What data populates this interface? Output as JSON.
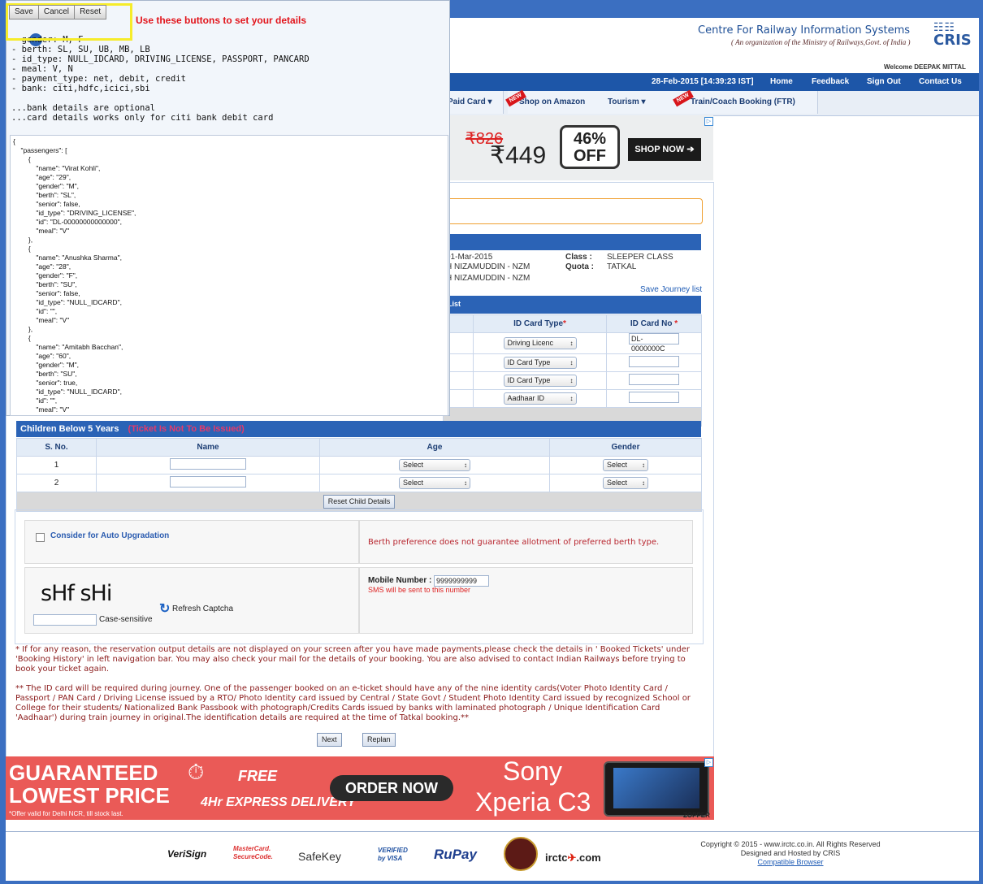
{
  "overlay": {
    "buttons": {
      "save": "Save",
      "cancel": "Cancel",
      "reset": "Reset"
    },
    "hint": "Use these buttons to set your details",
    "config_text": "- gender: M, F\n- berth: SL, SU, UB, MB, LB\n- id_type: NULL_IDCARD, DRIVING_LICENSE, PASSPORT, PANCARD\n- meal: V, N\n- payment_type: net, debit, credit\n- bank: citi,hdfc,icici,sbi\n\n...bank details are optional\n...card details works only for citi bank debit card",
    "json_text": "{\n    \"passengers\": [\n        {\n            \"name\": \"Virat Kohli\",\n            \"age\": \"29\",\n            \"gender\": \"M\",\n            \"berth\": \"SL\",\n            \"senior\": false,\n            \"id_type\": \"DRIVING_LICENSE\",\n            \"id\": \"DL-00000000000000\",\n            \"meal\": \"V\"\n        },\n        {\n            \"name\": \"Anushka Sharma\",\n            \"age\": \"28\",\n            \"gender\": \"F\",\n            \"berth\": \"SU\",\n            \"senior\": false,\n            \"id_type\": \"NULL_IDCARD\",\n            \"id\": \"\",\n            \"meal\": \"V\"\n        },\n        {\n            \"name\": \"Amitabh Bacchan\",\n            \"age\": \"60\",\n            \"gender\": \"M\",\n            \"berth\": \"SU\",\n            \"senior\": true,\n            \"id_type\": \"NULL_IDCARD\",\n            \"id\": \"\",\n            \"meal\": \"V\""
  },
  "header": {
    "title": "Centre For Railway Information Systems",
    "subtitle": "( An organization of the Ministry of Railways,Govt. of India )",
    "logo_text": "CRIS",
    "welcome": "Welcome DEEPAK MITTAL",
    "datetime": "28-Feb-2015 [14:39:23 IST]",
    "links": [
      "Home",
      "Feedback",
      "Sign Out",
      "Contact Us"
    ]
  },
  "menu": {
    "items": [
      "Paid Card ▾",
      "Shop on Amazon",
      "Tourism ▾",
      "Train/Coach Booking (FTR)"
    ],
    "new_badge": "NEW"
  },
  "ad_top": {
    "old_price": "₹826",
    "new_price": "₹449",
    "discount": "46%",
    "off": "OFF",
    "cta": "SHOP NOW"
  },
  "journey": {
    "date": "01-Mar-2015",
    "from": "H NIZAMUDDIN - NZM",
    "to": "H NIZAMUDDIN - NZM",
    "class_label": "Class :",
    "class_value": "SLEEPER CLASS",
    "quota_label": "Quota :",
    "quota_value": "TATKAL",
    "save_link": "Save Journey list",
    "list_label": "r List"
  },
  "passengers_table": {
    "headers": [
      "ID Card Type",
      "ID Card No"
    ],
    "rows": [
      {
        "id_type": "Driving Licenc",
        "id_no": "DL-0000000C"
      },
      {
        "id_type": "ID Card Type",
        "id_no": ""
      },
      {
        "id_type": "ID Card Type",
        "id_no": ""
      },
      {
        "id_type": "Aadhaar ID",
        "id_no": ""
      }
    ]
  },
  "children": {
    "title": "Children Below 5 Years",
    "warning": "(Ticket Is Not To Be Issued)",
    "headers": [
      "S. No.",
      "Name",
      "Age",
      "Gender"
    ],
    "rows": [
      {
        "sno": "1",
        "age": "Select",
        "gender": "Select"
      },
      {
        "sno": "2",
        "age": "Select",
        "gender": "Select"
      }
    ],
    "reset_button": "Reset Child Details"
  },
  "options": {
    "auto_upgrade": "Consider for Auto Upgradation",
    "berth_note": "Berth preference does not guarantee allotment of preferred berth type.",
    "captcha": "sHf sHi",
    "refresh": "Refresh Captcha",
    "case_sensitive": "Case-sensitive",
    "mobile_label": "Mobile Number :",
    "mobile_value": "9999999999",
    "sms_note": "SMS will be sent to this number"
  },
  "notes": {
    "note1": "* If for any reason, the reservation output details are not displayed on your screen after you have made payments,please check the details in ' Booked Tickets' under 'Booking History' in left navigation bar. You may also check your mail for the details of your booking. You are also advised to contact Indian Railways before trying to book your ticket again.",
    "note2": "** The ID card will be required during journey. One of the passenger booked on an e-ticket should have any of the nine identity cards(Voter Photo Identity Card / Passport / PAN Card / Driving License issued by a RTO/ Photo Identity card issued by Central / State Govt / Student Photo Identity Card issued by recognized School or College for their students/ Nationalized Bank Passbook with photograph/Credits Cards issued by banks with laminated photograph / Unique Identification Card 'Aadhaar') during train journey in original.The identification details are required at the time of Tatkal booking.**"
  },
  "actions": {
    "next": "Next",
    "replan": "Replan"
  },
  "ad_bottom": {
    "guaranteed": "GUARANTEED",
    "lowest": "LOWEST PRICE",
    "offer": "*Offer valid for Delhi NCR, till stock last.",
    "free": "FREE",
    "express": "4Hr EXPRESS DELIVERY",
    "order": "ORDER NOW",
    "brand": "Sony",
    "model": "Xperia C3",
    "zopper": "ZOPPER"
  },
  "footer": {
    "logos": [
      "VeriSign",
      "MasterCard. SecureCode.",
      "SafeKey",
      "VERIFIED by VISA",
      "RuPay",
      "irctc",
      ".com"
    ],
    "copyright": "Copyright © 2015 - www.irctc.co.in. All Rights Reserved",
    "hosted": "Designed and Hosted by CRIS",
    "compatible": "Compatible Browser"
  },
  "colors": {
    "accent": "#2b63b6",
    "warning": "#e2141b",
    "background": "#3b6fc1"
  }
}
